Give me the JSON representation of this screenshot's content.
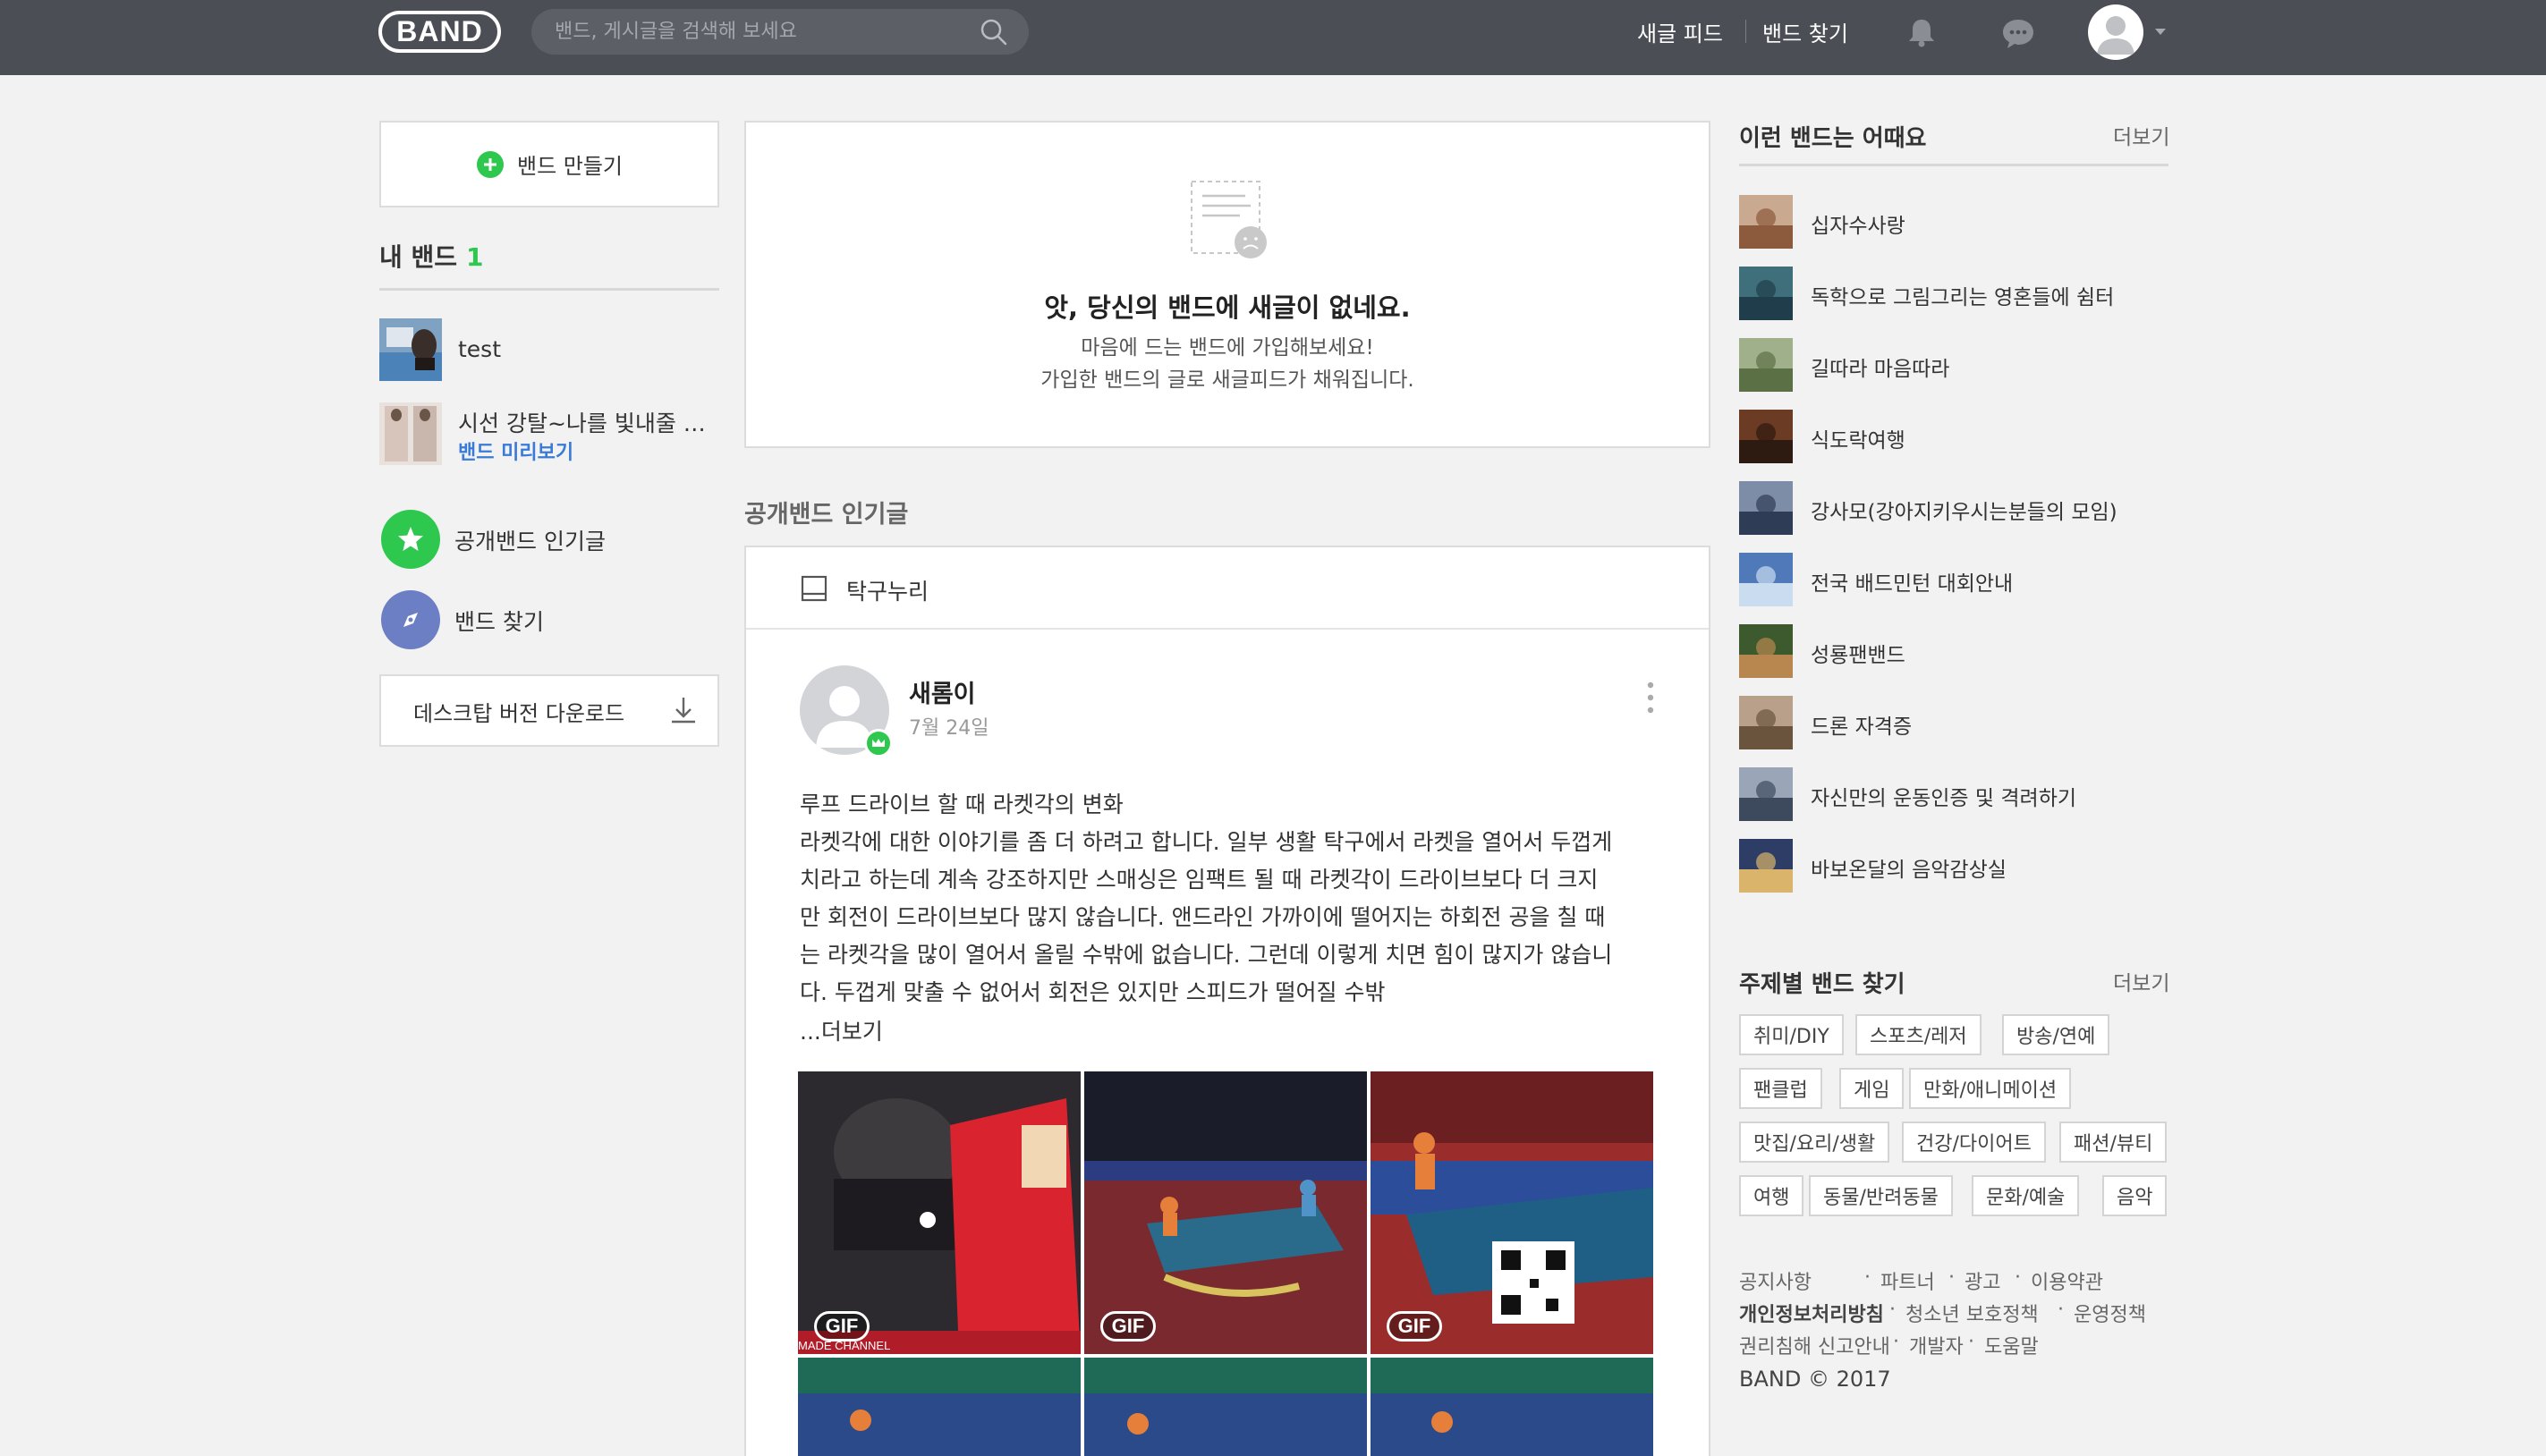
{
  "header": {
    "logo_text": "BAND",
    "search_placeholder": "밴드, 게시글을 검색해 보세요",
    "nav": [
      {
        "label": "새글 피드"
      },
      {
        "label": "밴드 찾기"
      }
    ],
    "colors": {
      "header_bg": "#4b4e55",
      "accent_green": "#2ec84e"
    }
  },
  "sidebar": {
    "create_band_label": "밴드 만들기",
    "my_bands_title": "내 밴드",
    "my_bands_count": "1",
    "bands": [
      {
        "name": "test"
      },
      {
        "name": "시선 강탈~나를 빛내줄 예쁜 옷 공유",
        "tag": "밴드 미리보기"
      }
    ],
    "links": [
      {
        "label": "공개밴드 인기글",
        "icon": "star-icon"
      },
      {
        "label": "밴드 찾기",
        "icon": "compass-icon"
      }
    ],
    "download_label": "데스크탑 버전 다운로드"
  },
  "main": {
    "empty": {
      "title": "앗, 당신의 밴드에 새글이 없네요.",
      "line1": "마음에 드는 밴드에 가입해보세요!",
      "line2": "가입한 밴드의 글로 새글피드가 채워집니다."
    },
    "popular_heading": "공개밴드 인기글",
    "post": {
      "band_name": "탁구누리",
      "author": "새롬이",
      "date": "7월 24일",
      "lines": [
        "루프 드라이브 할 때 라켓각의 변화",
        "라켓각에 대한 이야기를 좀 더 하려고 합니다. 일부 생활 탁구에서 라켓을 열어서 두껍게",
        "치라고 하는데 계속 강조하지만 스매싱은 임팩트 될 때 라켓각이 드라이브보다 더 크지",
        "만 회전이 드라이브보다 많지 않습니다. 앤드라인 가까이에 떨어지는 하회전 공을 칠 때",
        "는 라켓각을 많이 열어서 올릴 수밖에 없습니다. 그런데 이렇게 치면 힘이 많지가 않습니",
        "다. 두껍게 맞출 수 없어서 회전은 있지만 스피드가 떨어질 수밖"
      ],
      "more_label": "...더보기",
      "gif_label": "GIF",
      "watermark": "MADE CHANNEL"
    }
  },
  "right": {
    "rec_title": "이런 밴드는 어때요",
    "more_label": "더보기",
    "recommended": [
      {
        "name": "십자수사랑"
      },
      {
        "name": "독학으로 그림그리는 영혼들에 쉼터"
      },
      {
        "name": "길따라 마음따라"
      },
      {
        "name": "식도락여행"
      },
      {
        "name": "강사모(강아지키우시는분들의 모임)"
      },
      {
        "name": "전국 배드민턴 대회안내"
      },
      {
        "name": "성룡팬밴드"
      },
      {
        "name": "드론 자격증"
      },
      {
        "name": "자신만의 운동인증 및 격려하기"
      },
      {
        "name": "바보온달의 음악감상실"
      }
    ],
    "topic_title": "주제별 밴드 찾기",
    "topic_more": "더보기",
    "topics": [
      "취미/DIY",
      "스포츠/레저",
      "방송/연예",
      "팬클럽",
      "게임",
      "만화/애니메이션",
      "맛집/요리/생활",
      "건강/다이어트",
      "패션/뷰티",
      "여행",
      "동물/반려동물",
      "문화/예술",
      "음악"
    ],
    "footer": [
      "공지사항",
      "파트너",
      "광고",
      "이용약관",
      "개인정보처리방침",
      "청소년 보호정책",
      "운영정책",
      "권리침해 신고안내",
      "개발자",
      "도움말"
    ],
    "copyright": "BAND © 2017"
  }
}
